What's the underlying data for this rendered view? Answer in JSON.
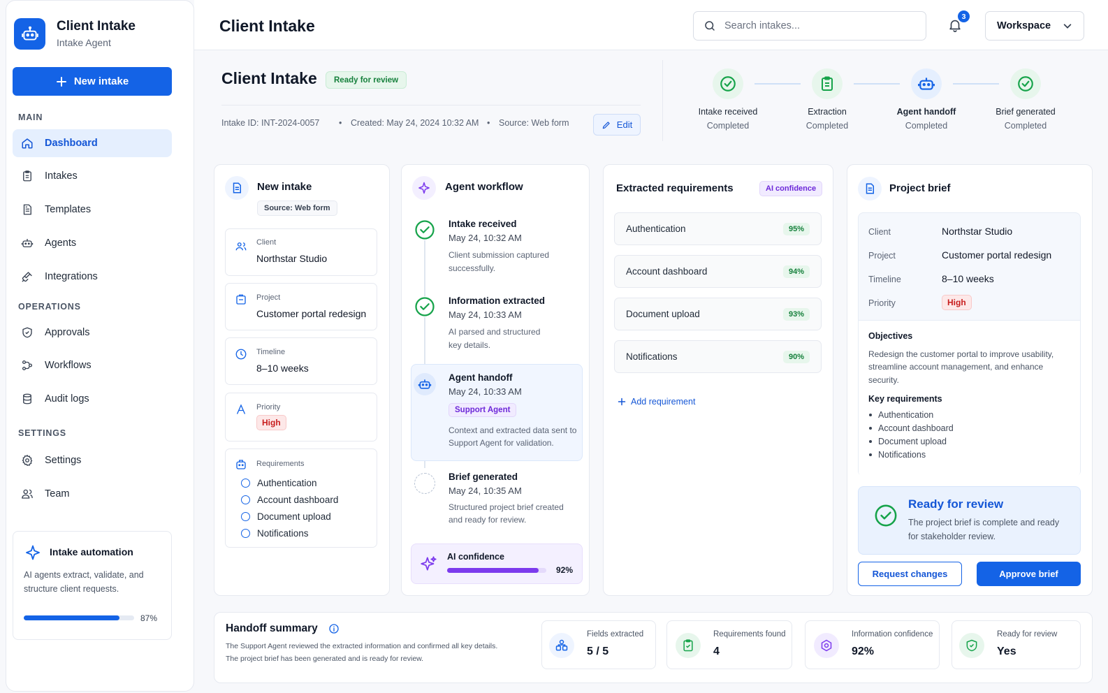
{
  "brand": {
    "title": "Client Intake",
    "subtitle": "Intake Agent"
  },
  "sidebar": {
    "new_intake_label": "New intake",
    "sections": {
      "main": "MAIN",
      "operations": "OPERATIONS",
      "settings": "SETTINGS"
    },
    "items": [
      {
        "label": "Dashboard",
        "icon": "home-icon",
        "active": true
      },
      {
        "label": "Intakes",
        "icon": "clipboard-icon"
      },
      {
        "label": "Templates",
        "icon": "document-icon"
      },
      {
        "label": "Agents",
        "icon": "robot-icon"
      },
      {
        "label": "Integrations",
        "icon": "plug-icon"
      },
      {
        "label": "Approvals",
        "icon": "shield-icon"
      },
      {
        "label": "Workflows",
        "icon": "workflow-icon"
      },
      {
        "label": "Audit logs",
        "icon": "database-icon"
      },
      {
        "label": "Settings",
        "icon": "gear-icon"
      },
      {
        "label": "Team",
        "icon": "team-icon"
      }
    ],
    "automation": {
      "title": "Intake automation",
      "desc_line1": "AI agents extract, validate, and",
      "desc_line2": "structure client requests.",
      "progress": 0.87,
      "progress_label": "87%"
    }
  },
  "header": {
    "title": "Client Intake",
    "search_placeholder": "Search intakes...",
    "notification_count": "3",
    "workspace_label": "Workspace"
  },
  "intake": {
    "title": "Client Intake",
    "status": "Ready for review",
    "id_text": "Intake ID: INT-2024-0057",
    "created_text": "Created: May 24, 2024 10:32 AM",
    "source_text": "Source: Web form",
    "edit_label": "Edit",
    "steps": [
      {
        "name": "Intake received",
        "status": "Completed",
        "icon": "check-circle-icon"
      },
      {
        "name": "Extraction",
        "status": "Completed",
        "icon": "clipboard-check-icon"
      },
      {
        "name": "Agent handoff",
        "status": "Completed",
        "icon": "robot-icon"
      },
      {
        "name": "Brief generated",
        "status": "Completed",
        "icon": "check-circle-icon"
      }
    ]
  },
  "new_intake_card": {
    "title": "New intake",
    "source_pill": "Source: Web form",
    "client_label": "Client",
    "client_value": "Northstar Studio",
    "project_label": "Project",
    "project_value": "Customer portal redesign",
    "timeline_label": "Timeline",
    "timeline_value": "8–10 weeks",
    "priority_label": "Priority",
    "priority_value": "High",
    "requirements_label": "Requirements",
    "requirements": [
      "Authentication",
      "Account dashboard",
      "Document upload",
      "Notifications"
    ]
  },
  "workflow": {
    "title": "Agent workflow",
    "steps": [
      {
        "title": "Intake received",
        "time": "May 24, 10:32 AM",
        "desc1": "Client submission captured",
        "desc2": "successfully."
      },
      {
        "title": "Information extracted",
        "time": "May 24, 10:33 AM",
        "desc1": "AI parsed and structured",
        "desc2": "key details."
      },
      {
        "title": "Agent handoff",
        "time": "May 24, 10:33 AM",
        "pill": "Support Agent",
        "desc1": "Context and extracted data sent to",
        "desc2": "Support Agent for validation."
      },
      {
        "title": "Brief generated",
        "time": "May 24, 10:35 AM",
        "desc1": "Structured project brief created",
        "desc2": "and ready for review."
      }
    ],
    "confidence_label": "AI confidence",
    "confidence_value": 0.92,
    "confidence_text": "92%"
  },
  "extracted": {
    "title": "Extracted requirements",
    "badge": "AI confidence",
    "items": [
      {
        "name": "Authentication",
        "pct": "95%"
      },
      {
        "name": "Account dashboard",
        "pct": "94%"
      },
      {
        "name": "Document upload",
        "pct": "93%"
      },
      {
        "name": "Notifications",
        "pct": "90%"
      }
    ],
    "add_label": "Add requirement"
  },
  "brief": {
    "title": "Project brief",
    "client_label": "Client",
    "client_value": "Northstar Studio",
    "project_label": "Project",
    "project_value": "Customer portal redesign",
    "timeline_label": "Timeline",
    "timeline_value": "8–10 weeks",
    "priority_label": "Priority",
    "priority_value": "High",
    "objectives_label": "Objectives",
    "objectives_line1": "Redesign the customer portal to improve usability,",
    "objectives_line2": "streamline account management, and enhance",
    "objectives_line3": "security.",
    "key_req_label": "Key requirements",
    "key_reqs": [
      "Authentication",
      "Account dashboard",
      "Document upload",
      "Notifications"
    ],
    "ready_title": "Ready for review",
    "ready_desc1": "The project brief is complete and ready",
    "ready_desc2": "for stakeholder review.",
    "request_changes_label": "Request changes",
    "approve_label": "Approve brief"
  },
  "handoff": {
    "title": "Handoff summary",
    "desc1": "The Support Agent reviewed the extracted information and confirmed all key details.",
    "desc2": "The project brief has been generated and is ready for review.",
    "stats": [
      {
        "label": "Fields extracted",
        "value": "5 / 5",
        "icon": "fields-icon"
      },
      {
        "label": "Requirements found",
        "value": "4",
        "icon": "clipboard-check-icon"
      },
      {
        "label": "Information confidence",
        "value": "92%",
        "icon": "target-icon"
      },
      {
        "label": "Ready for review",
        "value": "Yes",
        "icon": "shield-check-icon"
      }
    ]
  },
  "colors": {
    "accent": "#1463e6",
    "success": "#16a34a",
    "purple": "#7c3aed",
    "danger": "#c81e1e"
  }
}
